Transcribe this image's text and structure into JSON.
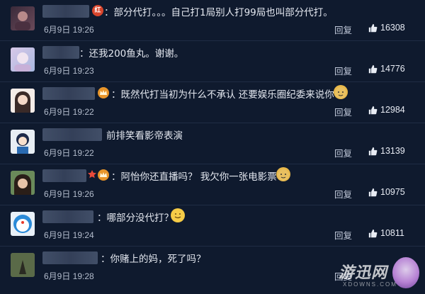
{
  "comments": [
    {
      "text": "：部分代打。。。自己打1局别人打99局也叫部分代打。",
      "time": "6月9日  19:26",
      "reply": "回复",
      "likes": "16308"
    },
    {
      "text": "：还我200鱼丸。谢谢。",
      "time": "6月9日  19:23",
      "reply": "回复",
      "likes": "14776"
    },
    {
      "text": "：既然代打当初为什么不承认 还要娱乐圈纪委来说你",
      "time": "6月9日  19:22",
      "reply": "回复",
      "likes": "12984"
    },
    {
      "text": "前排笑看影帝表演",
      "time": "6月9日  19:22",
      "reply": "回复",
      "likes": "13139"
    },
    {
      "text": "：阿怡你还直播吗？ 我欠你一张电影票",
      "time": "6月9日  19:26",
      "reply": "回复",
      "likes": "10975"
    },
    {
      "text": "：哪部分没代打？",
      "time": "6月9日  19:24",
      "reply": "回复",
      "likes": "10811"
    },
    {
      "text": "：你赌上的妈，死了吗？",
      "time": "6月9日  19:28",
      "reply": "回复",
      "likes": ""
    }
  ],
  "badges": {
    "first": "红"
  },
  "watermark": {
    "brand": "游迅网",
    "domain": "XDOWNS.COM"
  },
  "icons": {
    "like": "thumbs-up-icon",
    "emoji_dog": "doge-emoji-icon",
    "emoji_smile": "smile-emoji-icon"
  },
  "colors": {
    "background": "#0f1a2e",
    "badge_red": "#d8452c",
    "badge_orange": "#e8952a"
  }
}
